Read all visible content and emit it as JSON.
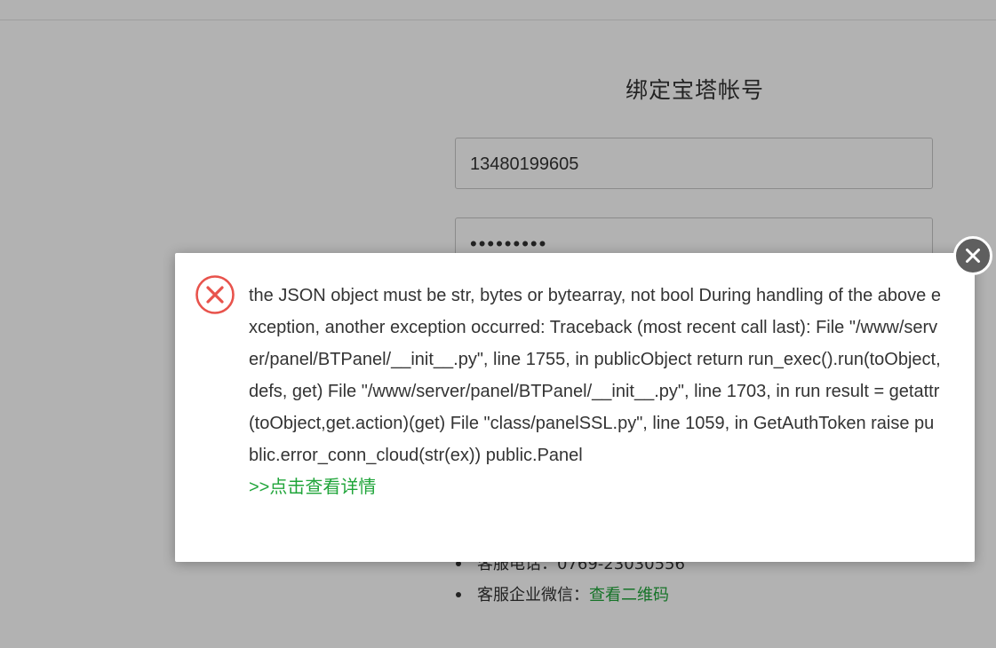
{
  "bind_form": {
    "title": "绑定宝塔帐号",
    "username_value": "13480199605",
    "password_value": "•••••••••"
  },
  "support": {
    "phone_label": "客服电话：0769-23030556",
    "wechat_label": "客服企业微信：",
    "wechat_link": "查看二维码"
  },
  "error_dialog": {
    "message": "the JSON object must be str, bytes or bytearray, not bool During handling of the above exception, another exception occurred: Traceback (most recent call last): File \"/www/server/panel/BTPanel/__init__.py\", line 1755, in publicObject return run_exec().run(toObject, defs, get) File \"/www/server/panel/BTPanel/__init__.py\", line 1703, in run result = getattr(toObject,get.action)(get) File \"class/panelSSL.py\", line 1059, in GetAuthToken raise public.error_conn_cloud(str(ex)) public.Panel",
    "detail_link": ">>点击查看详情"
  },
  "colors": {
    "accent_green": "#20a53a",
    "error_red": "#e8534c",
    "shade": "rgba(0,0,0,0.3)"
  },
  "icons": {
    "error": "error-circle-x-icon",
    "close": "close-circle-icon"
  }
}
